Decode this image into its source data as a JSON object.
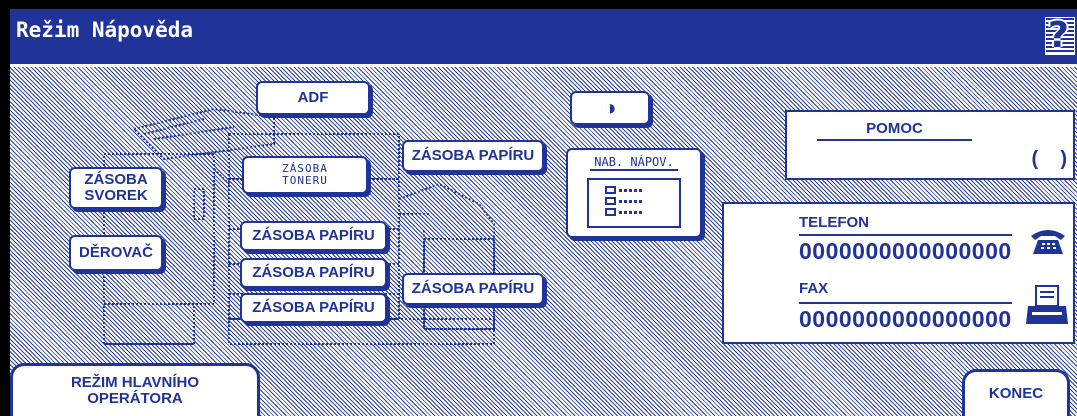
{
  "title": "Režim Nápověda",
  "help_icon": "question-mark-icon",
  "buttons": {
    "adf": "ADF",
    "contrast": "◑",
    "zasoba_toneru_line1": "ZÁSOBA",
    "zasoba_toneru_line2": "TONERU",
    "zasoba_papiru": "ZÁSOBA PAPÍRU",
    "zasoba_svorek_line1": "ZÁSOBA",
    "zasoba_svorek_line2": "SVOREK",
    "derovac": "DĚROVAČ",
    "nab_napov": "NAB. NÁPOV.",
    "rezim_hlavniho_line1": "REŽIM HLAVNÍHO",
    "rezim_hlavniho_line2": "OPERÁTORA",
    "konec": "KONEC"
  },
  "pomoc": {
    "label": "POMOC",
    "paren": "(    )"
  },
  "contact": {
    "telefon_label": "TELEFON",
    "telefon_value": "0000000000000000",
    "fax_label": "FAX",
    "fax_value": "0000000000000000"
  },
  "colors": {
    "primary": "#1f3398",
    "background": "#ffffff"
  }
}
